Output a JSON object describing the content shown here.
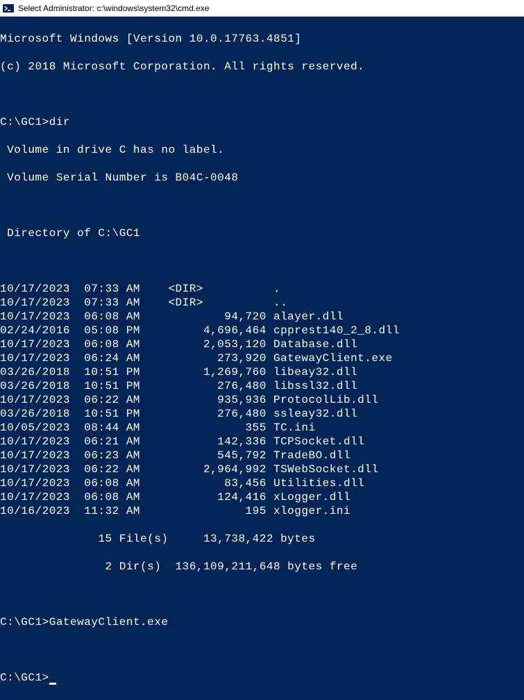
{
  "titlebar": {
    "text": "Select Administrator: c:\\windows\\system32\\cmd.exe"
  },
  "header": {
    "line1": "Microsoft Windows [Version 10.0.17763.4851]",
    "line2": "(c) 2018 Microsoft Corporation. All rights reserved."
  },
  "command1": {
    "prompt": "C:\\GC1>",
    "cmd": "dir"
  },
  "volume": {
    "line1": " Volume in drive C has no label.",
    "line2": " Volume Serial Number is B04C-0048"
  },
  "directory_of": " Directory of C:\\GC1",
  "entries": [
    "10/17/2023  07:33 AM    <DIR>          .",
    "10/17/2023  07:33 AM    <DIR>          ..",
    "10/17/2023  06:08 AM            94,720 alayer.dll",
    "02/24/2016  05:08 PM         4,696,464 cpprest140_2_8.dll",
    "10/17/2023  06:08 AM         2,053,120 Database.dll",
    "10/17/2023  06:24 AM           273,920 GatewayClient.exe",
    "03/26/2018  10:51 PM         1,269,760 libeay32.dll",
    "03/26/2018  10:51 PM           276,480 libssl32.dll",
    "10/17/2023  06:22 AM           935,936 ProtocolLib.dll",
    "03/26/2018  10:51 PM           276,480 ssleay32.dll",
    "10/05/2023  08:44 AM               355 TC.ini",
    "10/17/2023  06:21 AM           142,336 TCPSocket.dll",
    "10/17/2023  06:23 AM           545,792 TradeBO.dll",
    "10/17/2023  06:22 AM         2,964,992 TSWebSocket.dll",
    "10/17/2023  06:08 AM            83,456 Utilities.dll",
    "10/17/2023  06:08 AM           124,416 xLogger.dll",
    "10/16/2023  11:32 AM               195 xlogger.ini"
  ],
  "summary": {
    "files": "              15 File(s)     13,738,422 bytes",
    "dirs": "               2 Dir(s)  136,109,211,648 bytes free"
  },
  "command2": {
    "prompt": "C:\\GC1>",
    "cmd": "GatewayClient.exe"
  },
  "command3": {
    "prompt": "C:\\GC1>"
  }
}
